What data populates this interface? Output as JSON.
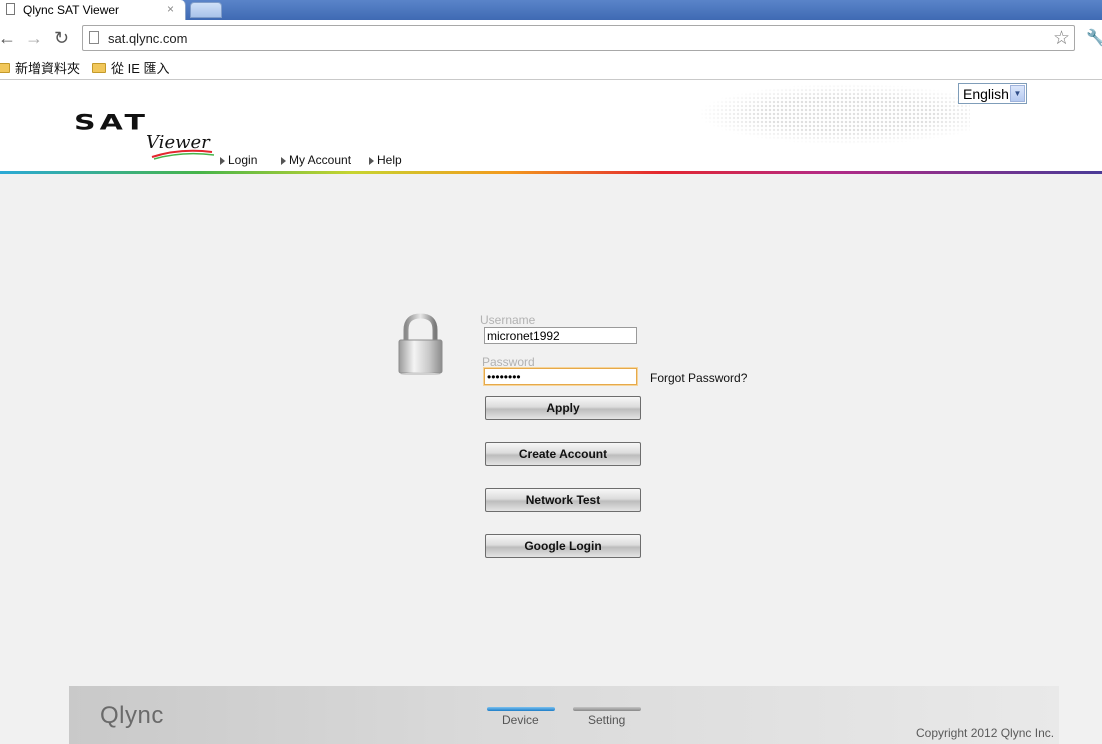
{
  "browser": {
    "tab_title": "Qlync SAT Viewer",
    "tab_close": "×",
    "url": "sat.qlync.com",
    "bookmarks": [
      {
        "label": "新增資料夾"
      },
      {
        "label": "從 IE 匯入"
      }
    ]
  },
  "header": {
    "logo_main": "SAT",
    "logo_sub": "Viewer",
    "language": "English",
    "nav": [
      {
        "label": "Login"
      },
      {
        "label": "My Account"
      },
      {
        "label": "Help"
      }
    ]
  },
  "login": {
    "username_label": "Username",
    "username_value": "micronet1992",
    "password_label": "Password",
    "password_value": "••••••••",
    "forgot_label": "Forgot Password?",
    "apply_label": "Apply",
    "create_account_label": "Create Account",
    "network_test_label": "Network Test",
    "google_login_label": "Google Login"
  },
  "footer": {
    "brand": "Qlync",
    "tabs": [
      {
        "label": "Device",
        "active": true
      },
      {
        "label": "Setting",
        "active": false
      }
    ],
    "copyright": "Copyright 2012 Qlync Inc."
  },
  "colors": {
    "accent_focus": "#e6a94a",
    "device_tab": "#1d7ec8"
  }
}
